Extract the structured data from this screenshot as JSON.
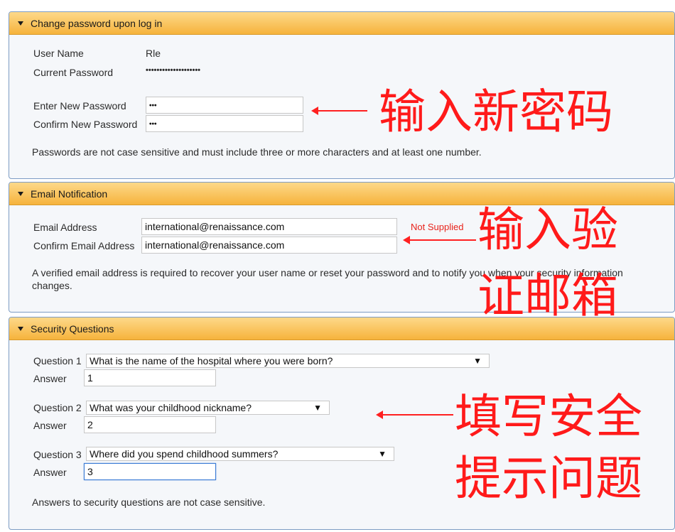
{
  "panels": {
    "change_password": {
      "title": "Change password upon log in",
      "user_name_label": "User Name",
      "user_name_value": "Rle",
      "current_password_label": "Current Password",
      "current_password_value": "••••••••••••••••••••",
      "new_password_label": "Enter New Password",
      "new_password_value": "•••",
      "confirm_password_label": "Confirm New Password",
      "confirm_password_value": "•••",
      "note": "Passwords are not case sensitive and must include three or more characters and at least one number."
    },
    "email": {
      "title": "Email Notification",
      "email_label": "Email Address",
      "email_value": "international@renaissance.com",
      "status": "Not Supplied",
      "confirm_email_label": "Confirm Email Address",
      "confirm_email_value": "international@renaissance.com",
      "note": "A verified email address is required to recover your user name or reset your password and to notify you when your security information changes."
    },
    "security": {
      "title": "Security Questions",
      "answer_label": "Answer",
      "questions": [
        {
          "label": "Question 1",
          "selected": "What is the name of the hospital where you were born?",
          "answer": "1"
        },
        {
          "label": "Question 2",
          "selected": "What was your childhood nickname?",
          "answer": "2"
        },
        {
          "label": "Question 3",
          "selected": "Where did you spend childhood summers?",
          "answer": "3"
        }
      ],
      "note": "Answers to security questions are not case sensitive."
    }
  },
  "annotations": {
    "password": "输入新密码",
    "email_line1": "输入验",
    "email_line2": "证邮箱",
    "security_line1": "填写安全",
    "security_line2": "提示问题"
  },
  "colors": {
    "header_gradient_top": "#fdd98a",
    "header_gradient_bottom": "#f6b33c",
    "panel_border": "#7d9cc4",
    "annotation_red": "#ff1a1a",
    "status_red": "#e8231b"
  },
  "icons": {
    "panel_toggle": "caret-down-icon",
    "dropdown": "triangle-down-icon"
  }
}
